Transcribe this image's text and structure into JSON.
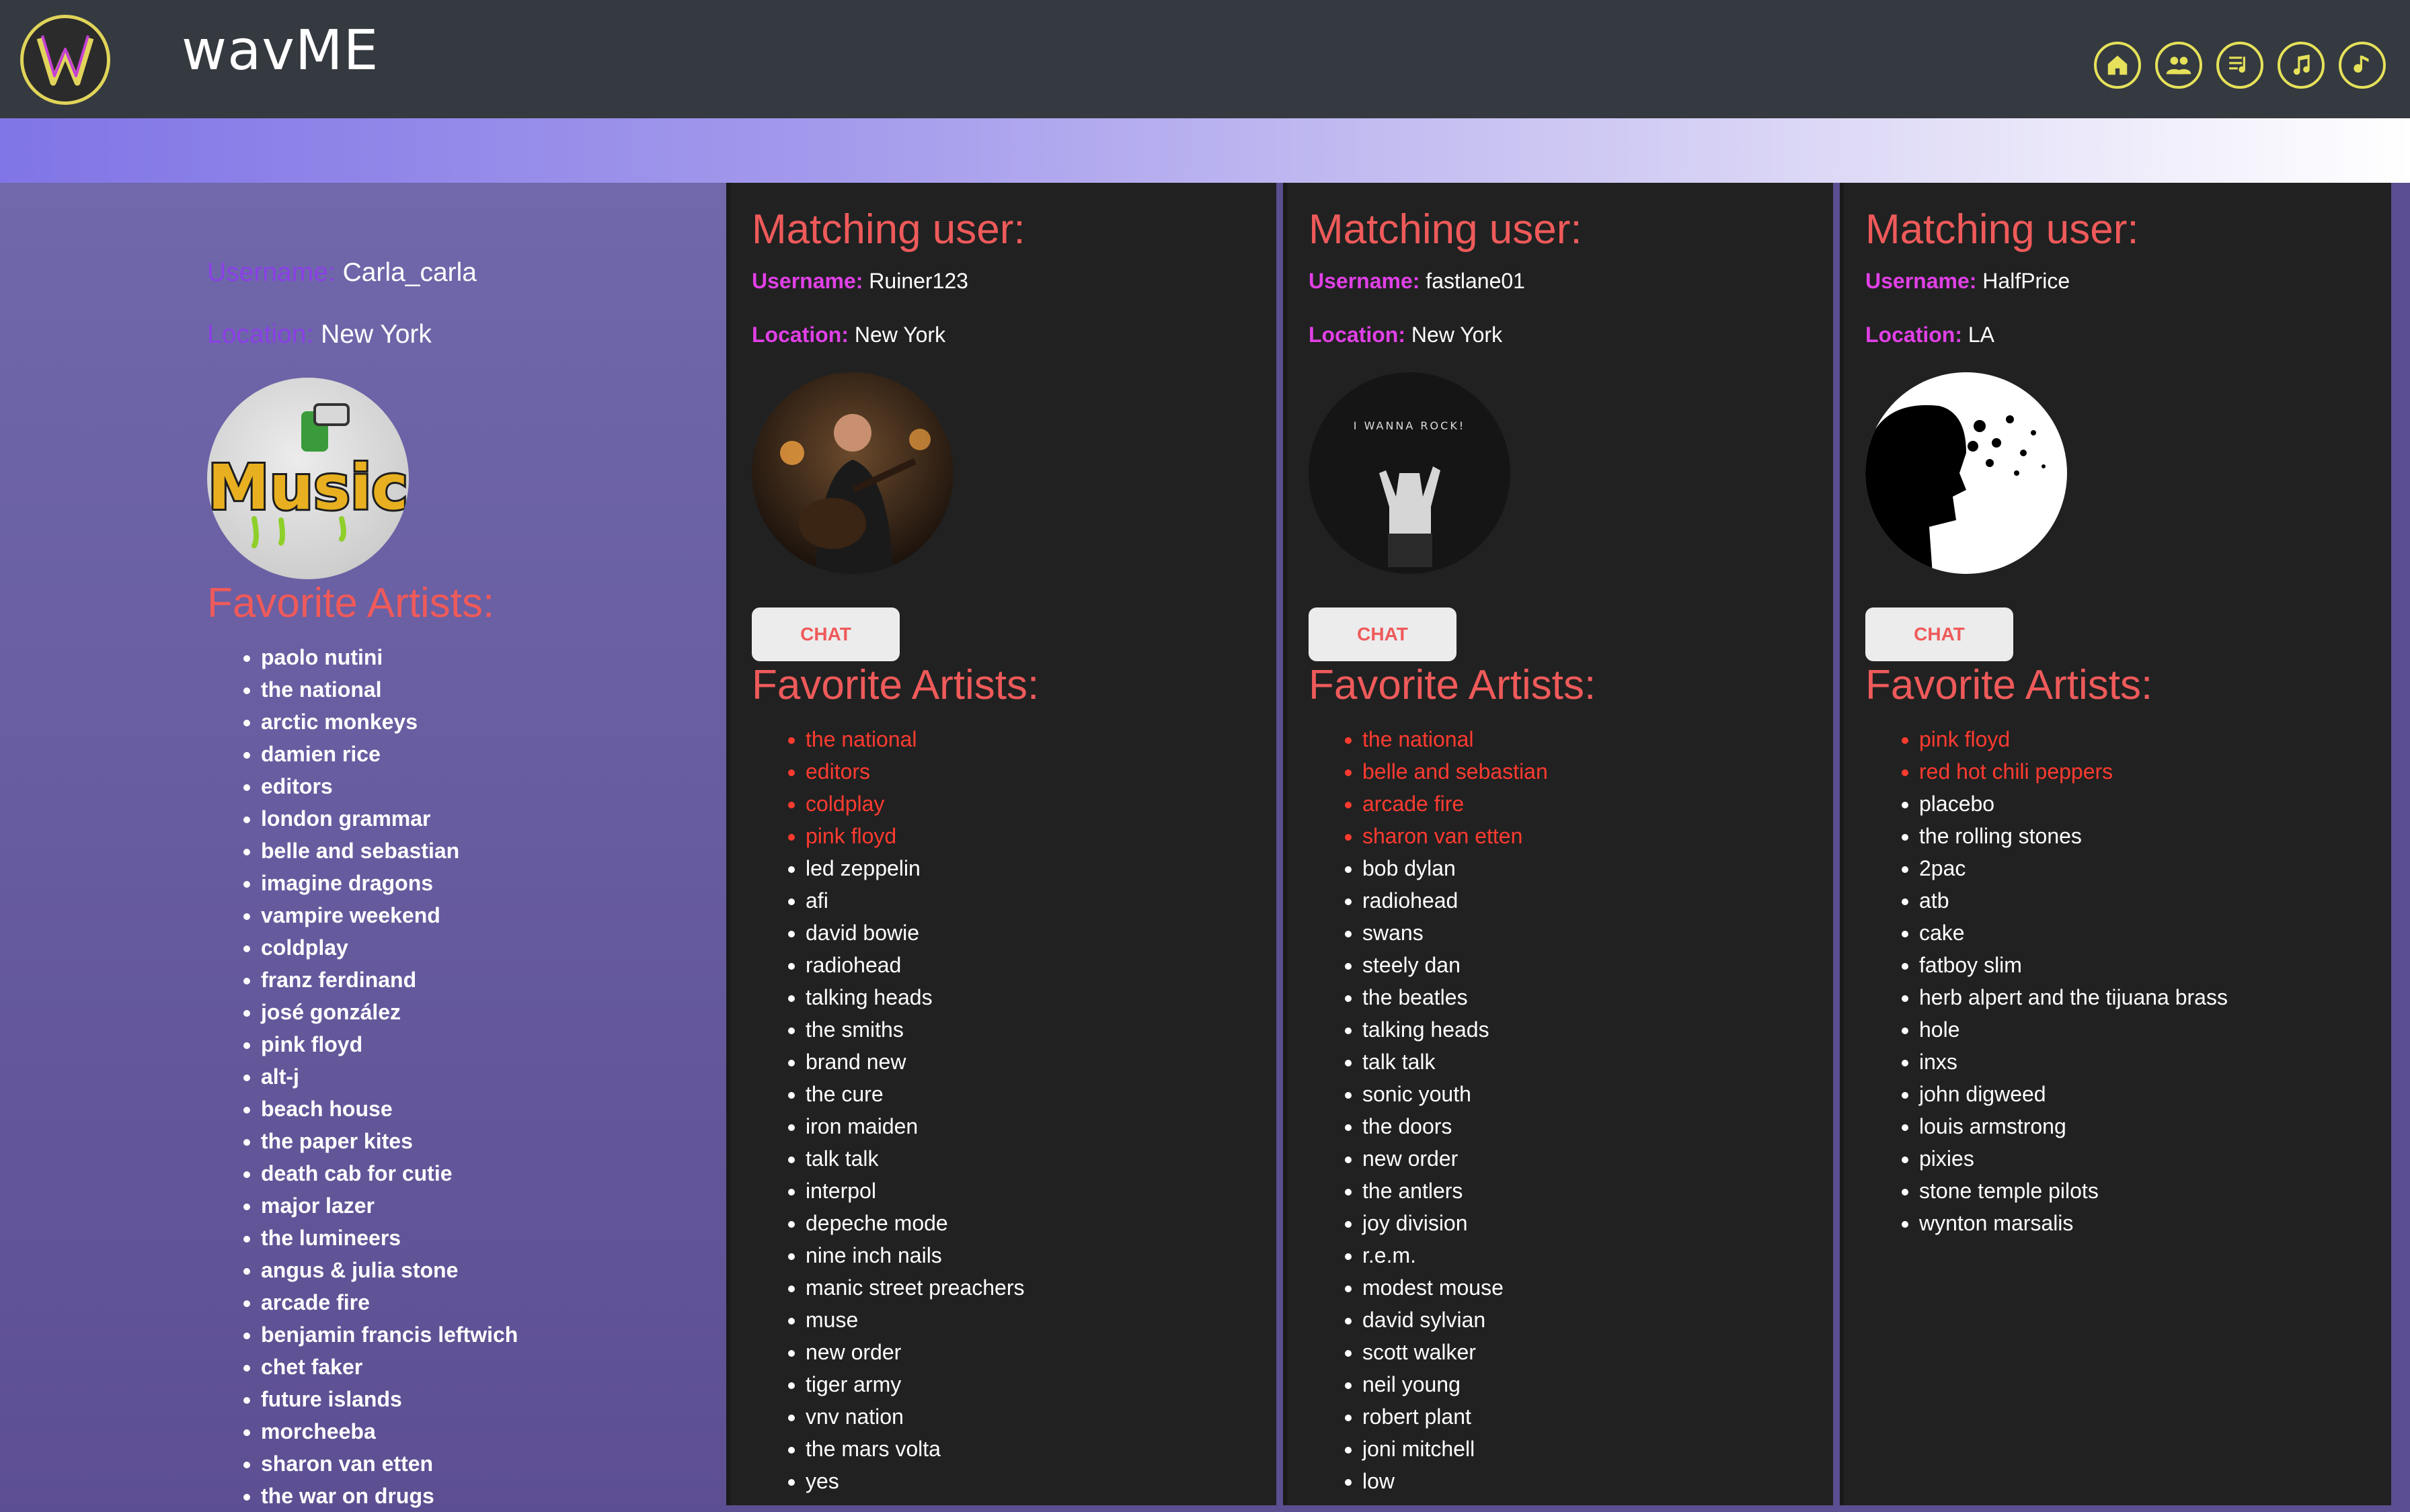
{
  "header": {
    "brand": "wavME",
    "nav": [
      "home-icon",
      "users-icon",
      "playlist-icon",
      "music-notes-icon",
      "music-note-icon"
    ],
    "accent": "#e6e15a"
  },
  "profile": {
    "username_label": "Username:",
    "username": "Carla_carla",
    "location_label": "Location:",
    "location": "New York",
    "avatar_text": "Music",
    "favorites_title": "Favorite Artists:",
    "artists": [
      "paolo nutini",
      "the national",
      "arctic monkeys",
      "damien rice",
      "editors",
      "london grammar",
      "belle and sebastian",
      "imagine dragons",
      "vampire weekend",
      "coldplay",
      "franz ferdinand",
      "josé gonzález",
      "pink floyd",
      "alt-j",
      "beach house",
      "the paper kites",
      "death cab for cutie",
      "major lazer",
      "the lumineers",
      "angus & julia stone",
      "arcade fire",
      "benjamin francis leftwich",
      "chet faker",
      "future islands",
      "morcheeba",
      "sharon van etten",
      "the war on drugs"
    ]
  },
  "matches": [
    {
      "title": "Matching user:",
      "username_label": "Username:",
      "username": "Ruiner123",
      "location_label": "Location:",
      "location": "New York",
      "chat_label": "CHAT",
      "favorites_title": "Favorite Artists:",
      "common": [
        "the national",
        "editors",
        "coldplay",
        "pink floyd"
      ],
      "others": [
        "led zeppelin",
        "afi",
        "david bowie",
        "radiohead",
        "talking heads",
        "the smiths",
        "brand new",
        "the cure",
        "iron maiden",
        "talk talk",
        "interpol",
        "depeche mode",
        "nine inch nails",
        "manic street preachers",
        "muse",
        "new order",
        "tiger army",
        "vnv nation",
        "the mars volta",
        "yes"
      ]
    },
    {
      "title": "Matching user:",
      "username_label": "Username:",
      "username": "fastlane01",
      "location_label": "Location:",
      "location": "New York",
      "chat_label": "CHAT",
      "avatar_text": "I WANNA ROCK!",
      "favorites_title": "Favorite Artists:",
      "common": [
        "the national",
        "belle and sebastian",
        "arcade fire",
        "sharon van etten"
      ],
      "others": [
        "bob dylan",
        "radiohead",
        "swans",
        "steely dan",
        "the beatles",
        "talking heads",
        "talk talk",
        "sonic youth",
        "the doors",
        "new order",
        "the antlers",
        "joy division",
        "r.e.m.",
        "modest mouse",
        "david sylvian",
        "scott walker",
        "neil young",
        "robert plant",
        "joni mitchell",
        "low"
      ]
    },
    {
      "title": "Matching user:",
      "username_label": "Username:",
      "username": "HalfPrice",
      "location_label": "Location:",
      "location": "LA",
      "chat_label": "CHAT",
      "favorites_title": "Favorite Artists:",
      "common": [
        "pink floyd",
        "red hot chili peppers"
      ],
      "others": [
        "placebo",
        "the rolling stones",
        "2pac",
        "atb",
        "cake",
        "fatboy slim",
        "herb alpert and the tijuana brass",
        "hole",
        "inxs",
        "john digweed",
        "louis armstrong",
        "pixies",
        "stone temple pilots",
        "wynton marsalis"
      ]
    }
  ]
}
